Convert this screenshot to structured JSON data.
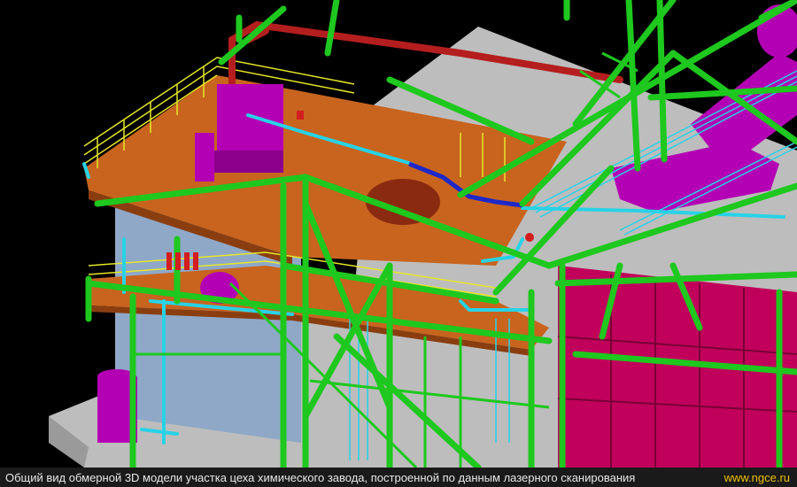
{
  "caption": {
    "text": "Общий вид обмерной 3D модели участка цеха химического завода, построенной по данным лазерного сканирования",
    "site": "www.ngce.ru"
  },
  "colors": {
    "background": "#000000",
    "floor": "#b8b8b8",
    "platform": "#c8641e",
    "steel": "#1ec81e",
    "railing": "#e6e628",
    "pipe": "#28d2e6",
    "equipment": "#b400b4",
    "panels": "#c80064",
    "red_pipe": "#b41e1e",
    "blue_pipe": "#1e28c8"
  }
}
